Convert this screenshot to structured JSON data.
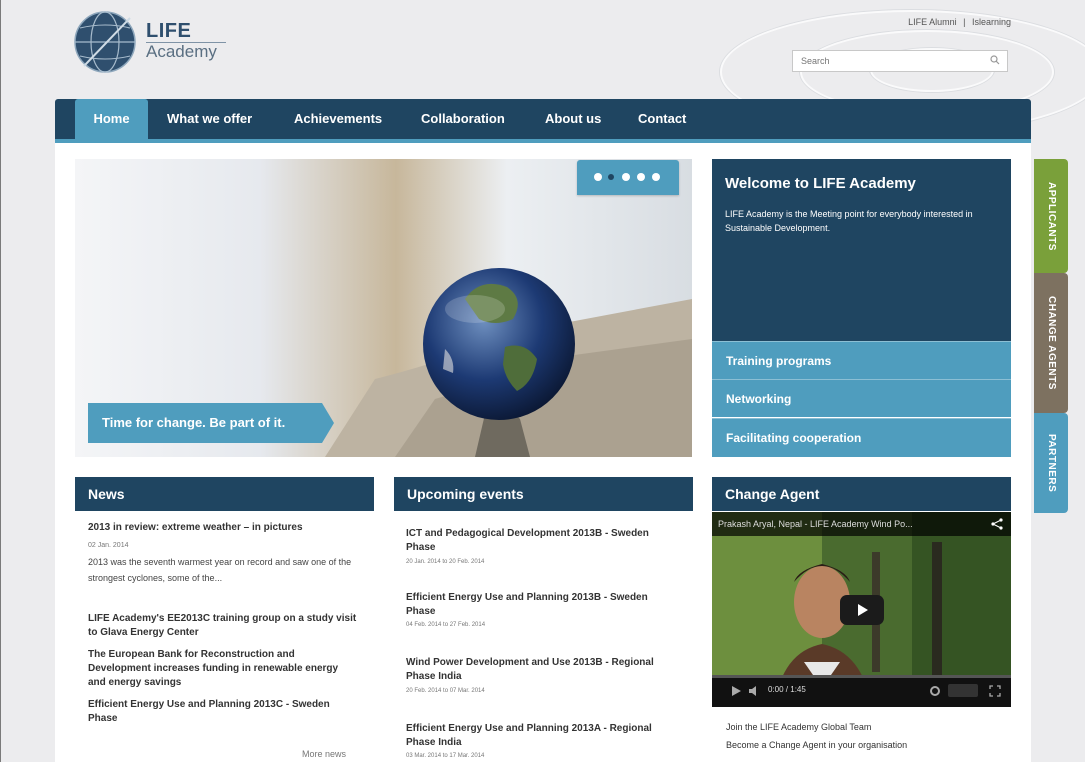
{
  "header": {
    "logo_line1": "LIFE",
    "logo_line2": "Academy",
    "top_links": [
      "LIFE Alumni",
      "|",
      "Islearning"
    ],
    "search_placeholder": "Search"
  },
  "nav": {
    "items": [
      "Home",
      "What we offer",
      "Achievements",
      "Collaboration",
      "About us",
      "Contact"
    ],
    "active_index": 0
  },
  "hero": {
    "caption": "Time for change. Be part of it.",
    "slide_count": 5,
    "active_slide": 1
  },
  "welcome": {
    "title": "Welcome to LIFE Academy",
    "text": "LIFE Academy is the Meeting point for everybody interested in Sustainable Development.",
    "links": [
      "Training programs",
      "Networking",
      "Facilitating cooperation"
    ]
  },
  "side_tabs": [
    {
      "label": "APPLICANTS",
      "color": "#7aa03a"
    },
    {
      "label": "CHANGE AGENTS",
      "color": "#7d7160"
    },
    {
      "label": "PARTNERS",
      "color": "#4f9dbe"
    }
  ],
  "news": {
    "title": "News",
    "items": [
      {
        "title": "2013 in review: extreme weather – in pictures",
        "date": "02 Jan. 2014",
        "excerpt": "2013 was the seventh warmest year on record and saw one of the strongest cyclones, some of the..."
      },
      {
        "title": "LIFE Academy's EE2013C training group on a study visit to Glava Energy Center"
      },
      {
        "title": "The European Bank for Reconstruction and Development increases funding in renewable energy and energy savings"
      },
      {
        "title": "Efficient Energy Use and Planning 2013C - Sweden Phase"
      }
    ],
    "more": "More news"
  },
  "events": {
    "title": "Upcoming events",
    "items": [
      {
        "title": "ICT and Pedagogical Development 2013B - Sweden Phase",
        "date": "20 Jan. 2014 to 20 Feb. 2014"
      },
      {
        "title": "Efficient Energy Use and Planning 2013B - Sweden Phase",
        "date": "04 Feb. 2014 to 27 Feb. 2014"
      },
      {
        "title": "Wind Power Development and Use 2013B - Regional Phase India",
        "date": "20 Feb. 2014 to 07 Mar. 2014"
      },
      {
        "title": "Efficient Energy Use and Planning 2013A - Regional Phase India",
        "date": "03 Mar. 2014 to 17 Mar. 2014"
      }
    ]
  },
  "change_agent": {
    "title": "Change Agent",
    "video_title": "Prakash Aryal, Nepal - LIFE Academy Wind Po...",
    "video_time": "0:00 / 1:45",
    "line1": "Join the LIFE Academy Global Team",
    "line2": "Become a Change Agent in your organisation"
  },
  "colors": {
    "navy": "#1f4561",
    "accent": "#4f9dbe",
    "green_tab": "#7aa03a",
    "brown_tab": "#7d7160"
  }
}
